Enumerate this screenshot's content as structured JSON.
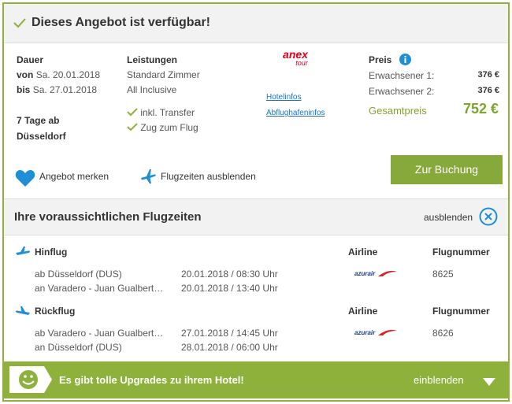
{
  "availability": {
    "title": "Dieses Angebot ist verfügbar!"
  },
  "duration": {
    "label": "Dauer",
    "from_prefix": "von",
    "from_date": "Sa. 20.01.2018",
    "to_prefix": "bis",
    "to_date": "Sa. 27.01.2018",
    "summary_line1": "7 Tage ab",
    "summary_line2": "Düsseldorf"
  },
  "services": {
    "label": "Leistungen",
    "room": "Standard Zimmer",
    "board": "All Inclusive",
    "extras": [
      "inkl. Transfer",
      "Zug zum Flug"
    ]
  },
  "operator": {
    "logo_text_top": "anex",
    "logo_text_bottom": "tour",
    "hotel_info_link": "Hotelinfos",
    "airport_info_link": "Abflughafeninfos"
  },
  "price": {
    "label": "Preis",
    "rows": [
      {
        "label": "Erwachsener 1:",
        "value": "376 €"
      },
      {
        "label": "Erwachsener 2:",
        "value": "376 €"
      }
    ],
    "total_label": "Gesamtpreis",
    "total_value": "752 €"
  },
  "actions": {
    "book": "Zur Buchung",
    "save": "Angebot merken",
    "flight_times_toggle": "Flugzeiten ausblenden"
  },
  "flight_times": {
    "title": "Ihre voraussichtlichen Flugzeiten",
    "hide_label": "ausblenden",
    "outbound": {
      "label": "Hinflug",
      "airline_header": "Airline",
      "number_header": "Flugnummer",
      "dep": "ab Düsseldorf (DUS)",
      "dep_time": "20.01.2018 / 08:30 Uhr",
      "arr": "an Varadero - Juan Gualbert…",
      "arr_time": "20.01.2018 / 13:40 Uhr",
      "airline_logo": "azurair",
      "flight_number": "8625"
    },
    "return": {
      "label": "Rückflug",
      "airline_header": "Airline",
      "number_header": "Flugnummer",
      "dep": "ab Varadero - Juan Gualbert…",
      "dep_time": "27.01.2018 / 14:45 Uhr",
      "arr": "an Düsseldorf (DUS)",
      "arr_time": "28.01.2018 / 06:00 Uhr",
      "airline_logo": "azurair",
      "flight_number": "8626"
    }
  },
  "upgrade": {
    "text": "Es gibt tolle Upgrades zu ihrem Hotel!",
    "show_label": "einblenden"
  },
  "colors": {
    "accent_green": "#8db13a",
    "link_blue": "#1b74c4",
    "info_blue": "#1e8fd6"
  }
}
